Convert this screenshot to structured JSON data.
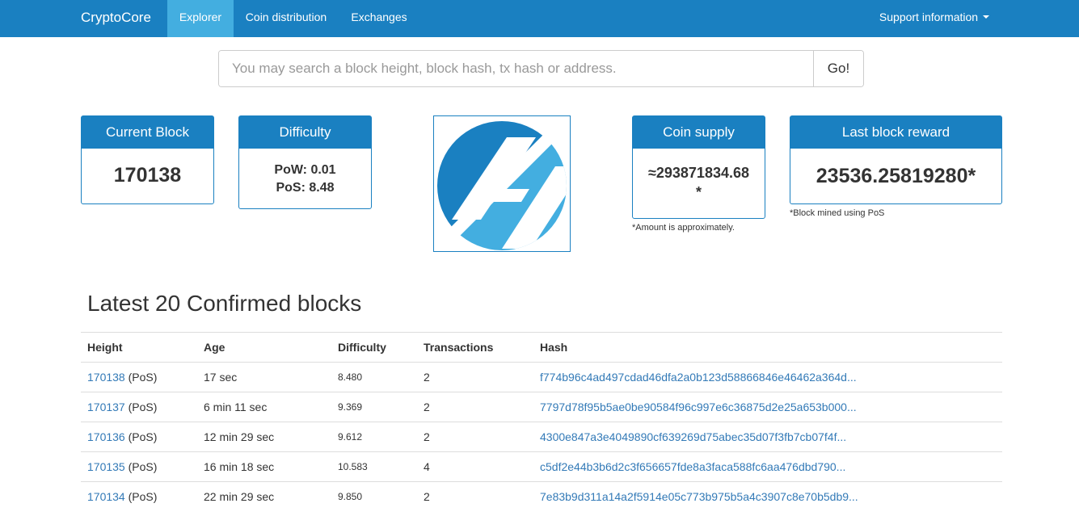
{
  "navbar": {
    "brand": "CryptoCore",
    "items": [
      {
        "label": "Explorer",
        "active": true
      },
      {
        "label": "Coin distribution",
        "active": false
      },
      {
        "label": "Exchanges",
        "active": false
      }
    ],
    "support": "Support information"
  },
  "search": {
    "placeholder": "You may search a block height, block hash, tx hash or address.",
    "button": "Go!"
  },
  "stats": {
    "current_block": {
      "title": "Current Block",
      "value": "170138"
    },
    "difficulty": {
      "title": "Difficulty",
      "pow": "PoW: 0.01",
      "pos": "PoS: 8.48"
    },
    "coin_supply": {
      "title": "Coin supply",
      "value_line1": "≈293871834.68",
      "value_line2": "*",
      "note": "*Amount is approximately."
    },
    "last_reward": {
      "title": "Last block reward",
      "value": "23536.25819280*",
      "note": "*Block mined using PoS"
    }
  },
  "colors": {
    "brand": "#1a80c1",
    "active_nav": "#43aee0",
    "link": "#337ab7",
    "logo_dark": "#1a80c1",
    "logo_light": "#43aee0"
  },
  "blocks": {
    "title": "Latest 20 Confirmed blocks",
    "headers": {
      "height": "Height",
      "age": "Age",
      "difficulty": "Difficulty",
      "transactions": "Transactions",
      "hash": "Hash"
    },
    "rows": [
      {
        "height": "170138",
        "type": "(PoS)",
        "age": "17 sec",
        "difficulty": "8.480",
        "tx": "2",
        "hash": "f774b96c4ad497cdad46dfa2a0b123d58866846e46462a364d..."
      },
      {
        "height": "170137",
        "type": "(PoS)",
        "age": "6 min 11 sec",
        "difficulty": "9.369",
        "tx": "2",
        "hash": "7797d78f95b5ae0be90584f96c997e6c36875d2e25a653b000..."
      },
      {
        "height": "170136",
        "type": "(PoS)",
        "age": "12 min 29 sec",
        "difficulty": "9.612",
        "tx": "2",
        "hash": "4300e847a3e4049890cf639269d75abec35d07f3fb7cb07f4f..."
      },
      {
        "height": "170135",
        "type": "(PoS)",
        "age": "16 min 18 sec",
        "difficulty": "10.583",
        "tx": "4",
        "hash": "c5df2e44b3b6d2c3f656657fde8a3faca588fc6aa476dbd790..."
      },
      {
        "height": "170134",
        "type": "(PoS)",
        "age": "22 min 29 sec",
        "difficulty": "9.850",
        "tx": "2",
        "hash": "7e83b9d311a14a2f5914e05c773b975b5a4c3907c8e70b5db9..."
      }
    ]
  }
}
